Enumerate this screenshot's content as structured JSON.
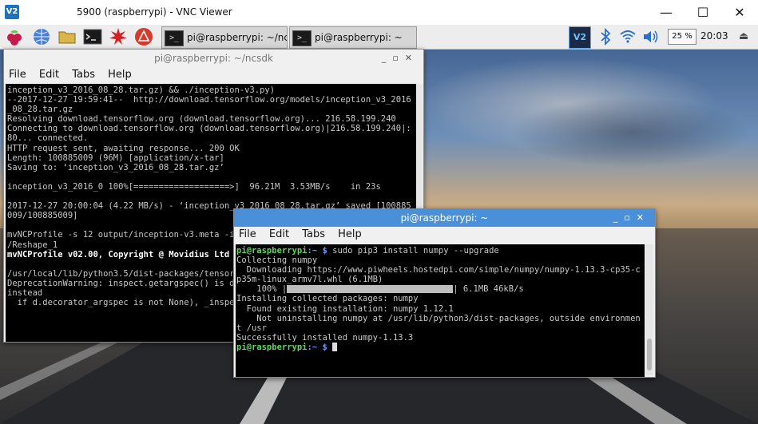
{
  "vnc": {
    "logo": "V2",
    "title": "5900 (raspberrypi) - VNC Viewer",
    "minimize": "—",
    "maximize": "☐",
    "close": "✕"
  },
  "panel": {
    "launchers": [
      "raspberry-menu-icon",
      "web-browser-icon",
      "file-manager-icon",
      "terminal-icon",
      "mathematica-icon",
      "wolfram-icon"
    ],
    "tasks": [
      {
        "label": "pi@raspberrypi: ~/nc",
        "icon": ">_"
      },
      {
        "label": "pi@raspberrypi: ~",
        "icon": ">_"
      }
    ],
    "tray_vnc": "V2",
    "cpu": "25 %",
    "clock": "20:03"
  },
  "term1": {
    "title": "pi@raspberrypi: ~/ncsdk",
    "menu": [
      "File",
      "Edit",
      "Tabs",
      "Help"
    ],
    "lines": [
      "inception_v3_2016_08_28.tar.gz) && ./inception-v3.py)",
      "--2017-12-27 19:59:41--  http://download.tensorflow.org/models/inception_v3_2016",
      "_08_28.tar.gz",
      "Resolving download.tensorflow.org (download.tensorflow.org)... 216.58.199.240",
      "Connecting to download.tensorflow.org (download.tensorflow.org)|216.58.199.240|:",
      "80... connected.",
      "HTTP request sent, awaiting response... 200 OK",
      "Length: 100885009 (96M) [application/x-tar]",
      "Saving to: ‘inception_v3_2016_08_28.tar.gz’",
      "",
      "inception_v3_2016_0 100%[===================>]  96.21M  3.53MB/s    in 23s",
      "",
      "2017-12-27 20:00:04 (4.22 MB/s) - ‘inception_v3_2016_08_28.tar.gz’ saved [100885",
      "009/100885009]",
      "",
      "mvNCProfile -s 12 output/inception-v3.meta -i",
      "/Reshape_1",
      "mvNCProfile v02.00, Copyright @ Movidius Ltd",
      "",
      "/usr/local/lib/python3.5/dist-packages/tensor",
      "DeprecationWarning: inspect.getargspec() is d",
      "instead",
      "  if d.decorator_argspec is not None), _inspe"
    ]
  },
  "term2": {
    "title": "pi@raspberrypi: ~",
    "menu": [
      "File",
      "Edit",
      "Tabs",
      "Help"
    ],
    "prompt_user": "pi@raspberrypi",
    "prompt_path": ":~ $",
    "command": " sudo pip3 install numpy --upgrade",
    "lines": [
      "Collecting numpy",
      "  Downloading https://www.piwheels.hostedpi.com/simple/numpy/numpy-1.13.3-cp35-c",
      "p35m-linux_armv7l.whl (6.1MB)"
    ],
    "progress_prefix": "    100% |",
    "progress_suffix": "| 6.1MB 46kB/s",
    "progress_fraction": 1.0,
    "lines2": [
      "Installing collected packages: numpy",
      "  Found existing installation: numpy 1.12.1",
      "    Not uninstalling numpy at /usr/lib/python3/dist-packages, outside environmen",
      "t /usr",
      "Successfully installed numpy-1.13.3"
    ]
  }
}
